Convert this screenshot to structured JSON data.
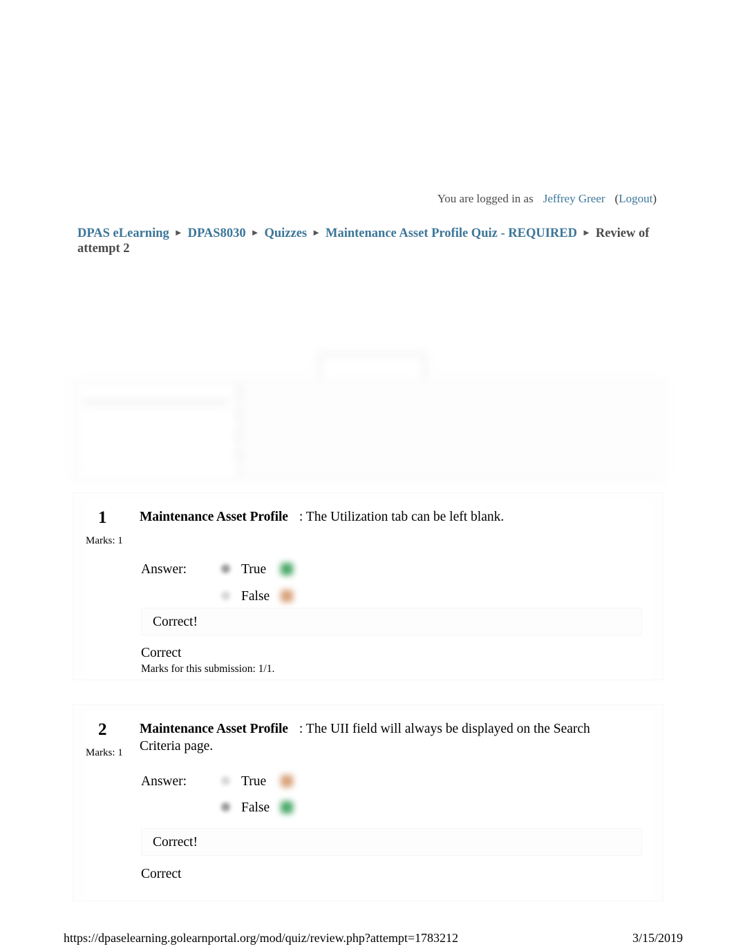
{
  "session": {
    "logged_in_prefix": "You are logged in as",
    "user_name": "Jeffrey Greer",
    "paren_open": "(",
    "logout_label": "Logout",
    "paren_close": ")"
  },
  "breadcrumb": {
    "items": [
      {
        "label": "DPAS eLearning",
        "link": true
      },
      {
        "label": "DPAS8030",
        "link": true
      },
      {
        "label": "Quizzes",
        "link": true
      },
      {
        "label": "Maintenance Asset Profile Quiz - REQUIRED",
        "link": true
      },
      {
        "label": "Review of attempt 2",
        "link": false
      }
    ],
    "separator": "►"
  },
  "questions": [
    {
      "number": "1",
      "marks_label": "Marks: 1",
      "title": "Maintenance Asset Profile",
      "prompt": ": The Utilization tab can be left blank.",
      "answer_label": "Answer:",
      "choices": [
        {
          "label": "True",
          "selected": true,
          "mark": "correct"
        },
        {
          "label": "False",
          "selected": false,
          "mark": "wrong"
        }
      ],
      "feedback": "Correct!",
      "verdict": "Correct",
      "submission_marks": "Marks for this submission: 1/1."
    },
    {
      "number": "2",
      "marks_label": "Marks: 1",
      "title": "Maintenance Asset Profile",
      "prompt": ": The UII field will always be displayed on the Search Criteria page.",
      "answer_label": "Answer:",
      "choices": [
        {
          "label": "True",
          "selected": false,
          "mark": "wrong"
        },
        {
          "label": "False",
          "selected": true,
          "mark": "correct"
        }
      ],
      "feedback": "Correct!",
      "verdict": "Correct",
      "submission_marks": ""
    }
  ],
  "footer": {
    "url": "https://dpaselearning.golearnportal.org/mod/quiz/review.php?attempt=1783212",
    "date": "3/15/2019"
  },
  "colors": {
    "link": "#3c7699",
    "body_text": "#000000",
    "muted": "#4a4a4a",
    "correct": "#4aa868",
    "incorrect": "#d8a27a"
  }
}
